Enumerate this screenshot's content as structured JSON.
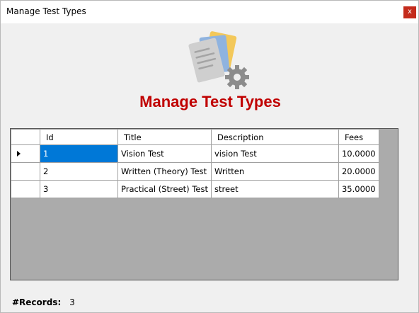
{
  "window": {
    "title": "Manage Test Types",
    "close_label": "x"
  },
  "header": {
    "title": "Manage Test Types",
    "icon": "document-settings-icon"
  },
  "grid": {
    "columns": [
      "Id",
      "Title",
      "Description",
      "Fees"
    ],
    "rows": [
      {
        "id": "1",
        "title": "Vision Test",
        "description": "vision Test",
        "fees": "10.0000",
        "selected": true
      },
      {
        "id": "2",
        "title": "Written (Theory) Test",
        "description": "Written",
        "fees": "20.0000"
      },
      {
        "id": "3",
        "title": "Practical (Street) Test",
        "description": "street",
        "fees": "35.0000"
      }
    ]
  },
  "footer": {
    "records_label": "#Records:",
    "records_value": "3"
  },
  "colors": {
    "title_red": "#c00000",
    "selection_blue": "#0078d7",
    "close_red": "#c42b1c"
  }
}
